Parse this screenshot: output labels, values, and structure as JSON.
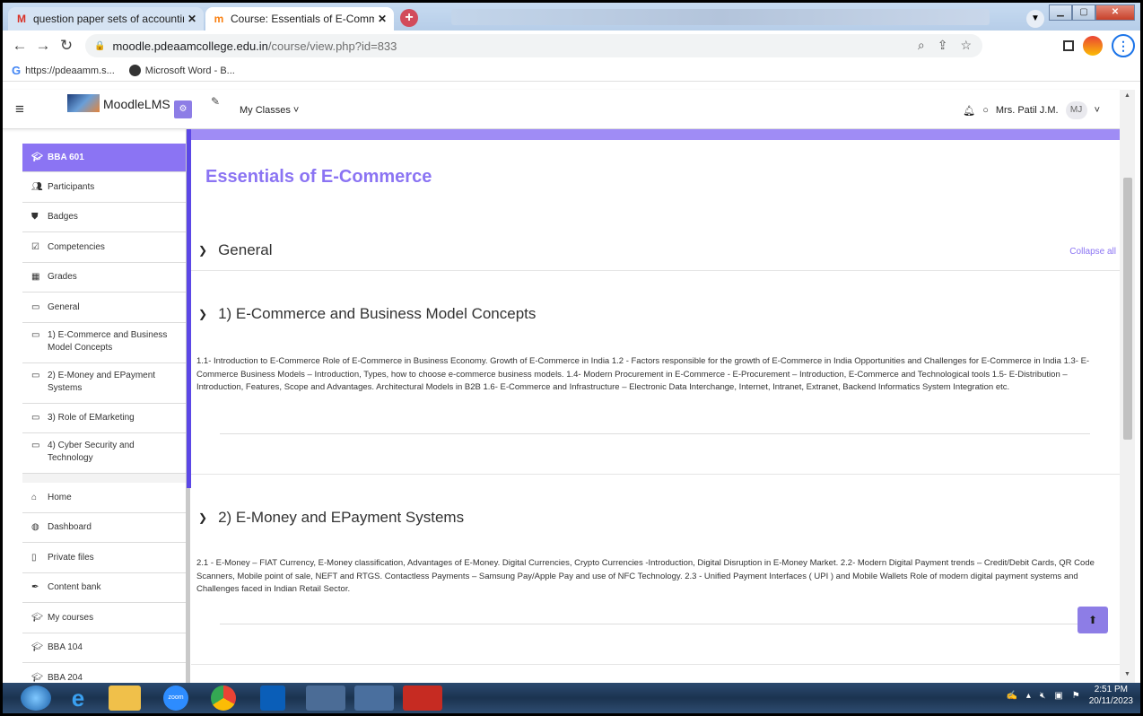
{
  "browser": {
    "tabs": [
      {
        "favicon": "M",
        "title": "question paper sets of accounting",
        "active": false
      },
      {
        "favicon": "m",
        "title": "Course: Essentials of E-Commerce",
        "active": true
      }
    ],
    "new_tab": "+",
    "url_host": "moodle.pdeaamcollege.edu.in",
    "url_path": "/course/view.php?id=833",
    "bookmarks": [
      "https://pdeaamm.s...",
      "Microsoft Word - B..."
    ]
  },
  "navbar": {
    "brand": "MoodleLMS",
    "my_classes": "My Classes ˅",
    "user_name": "Mrs. Patil J.M.",
    "user_initials": "MJ"
  },
  "sidebar": {
    "course_items": [
      {
        "icon": "graduation-cap-icon",
        "label": "BBA 601",
        "active": true
      },
      {
        "icon": "users-icon",
        "label": "Participants"
      },
      {
        "icon": "shield-icon",
        "label": "Badges"
      },
      {
        "icon": "checkbox-icon",
        "label": "Competencies"
      },
      {
        "icon": "table-icon",
        "label": "Grades"
      },
      {
        "icon": "folder-icon",
        "label": "General"
      },
      {
        "icon": "folder-icon",
        "label": "1) E-Commerce and Business Model Concepts"
      },
      {
        "icon": "folder-icon",
        "label": "2) E-Money and EPayment Systems"
      },
      {
        "icon": "folder-icon",
        "label": "3) Role of EMarketing"
      },
      {
        "icon": "folder-icon",
        "label": "4) Cyber Security and Technology"
      }
    ],
    "site_items": [
      {
        "icon": "home-icon",
        "label": "Home"
      },
      {
        "icon": "dashboard-icon",
        "label": "Dashboard"
      },
      {
        "icon": "file-icon",
        "label": "Private files"
      },
      {
        "icon": "pen-icon",
        "label": "Content bank"
      },
      {
        "icon": "graduation-cap-icon",
        "label": "My courses"
      },
      {
        "icon": "graduation-cap-icon",
        "label": "BBA 104"
      },
      {
        "icon": "graduation-cap-icon",
        "label": "BBA 204"
      }
    ]
  },
  "main": {
    "course_title": "Essentials of E-Commerce",
    "collapse_all": "Collapse all",
    "sections": [
      {
        "title": "General",
        "expanded": false,
        "summary": ""
      },
      {
        "title": "1) E-Commerce and Business Model Concepts",
        "expanded": true,
        "summary": "1.1- Introduction to E-Commerce Role of E-Commerce in Business Economy. Growth of E-Commerce in India 1.2 - Factors responsible for the growth of E-Commerce in India Opportunities and Challenges for E-Commerce in India 1.3- E-Commerce Business Models – Introduction, Types, how to choose e-commerce business models. 1.4- Modern Procurement in E-Commerce - E-Procurement – Introduction, E-Commerce and Technological tools 1.5- E-Distribution – Introduction, Features, Scope and Advantages. Architectural Models in B2B 1.6- E-Commerce and Infrastructure – Electronic Data Interchange, Internet, Intranet, Extranet, Backend Informatics System Integration etc."
      },
      {
        "title": "2) E-Money and EPayment Systems",
        "expanded": true,
        "summary": "2.1 - E-Money – FIAT Currency, E-Money classification, Advantages of E-Money. Digital Currencies, Crypto Currencies -Introduction, Digital Disruption in E-Money Market. 2.2- Modern Digital Payment trends – Credit/Debit Cards, QR Code Scanners, Mobile point of sale, NEFT and RTGS. Contactless Payments – Samsung Pay/Apple Pay and use of NFC Technology. 2.3 - Unified Payment Interfaces ( UPI ) and Mobile Wallets Role of modern digital payment systems and Challenges faced in Indian Retail Sector."
      }
    ]
  },
  "taskbar": {
    "zoom_label": "zoom",
    "time": "2:51 PM",
    "date": "20/11/2023"
  },
  "colors": {
    "accent": "#8b74f3",
    "accent_dark": "#5b47e6"
  }
}
